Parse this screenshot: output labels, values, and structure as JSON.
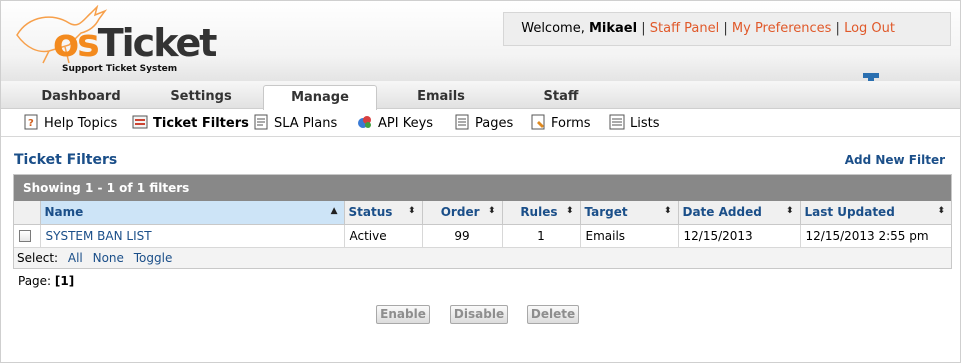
{
  "header": {
    "logo_text_os": "os",
    "logo_text_ticket": "Ticket",
    "logo_tagline": "Support Ticket System",
    "welcome_prefix": "Welcome,",
    "username": "Mikael",
    "links": [
      "Staff Panel",
      "My Preferences",
      "Log Out"
    ],
    "separator": "|",
    "accent_color": "#e0592a"
  },
  "nav": {
    "tabs": [
      {
        "label": "Dashboard",
        "active": false
      },
      {
        "label": "Settings",
        "active": false
      },
      {
        "label": "Manage",
        "active": true
      },
      {
        "label": "Emails",
        "active": false
      },
      {
        "label": "Staff",
        "active": false
      }
    ]
  },
  "subnav": {
    "items": [
      {
        "label": "Help Topics",
        "icon": "help-topics-icon",
        "active": false
      },
      {
        "label": "Ticket Filters",
        "icon": "ticket-filters-icon",
        "active": true
      },
      {
        "label": "SLA Plans",
        "icon": "sla-plans-icon",
        "active": false
      },
      {
        "label": "API Keys",
        "icon": "api-keys-icon",
        "active": false
      },
      {
        "label": "Pages",
        "icon": "pages-icon",
        "active": false
      },
      {
        "label": "Forms",
        "icon": "forms-icon",
        "active": false
      },
      {
        "label": "Lists",
        "icon": "lists-icon",
        "active": false
      }
    ]
  },
  "page": {
    "title": "Ticket Filters",
    "add_new": "Add New Filter",
    "showing": "Showing  1 - 1 of 1 filters",
    "title_color": "#1b4f89"
  },
  "table": {
    "columns": [
      "Name",
      "Status",
      "Order",
      "Rules",
      "Target",
      "Date Added",
      "Last Updated"
    ],
    "rows": [
      {
        "name": "SYSTEM BAN LIST",
        "status": "Active",
        "order": "99",
        "rules": "1",
        "target": "Emails",
        "date_added": "12/15/2013",
        "last_updated": "12/15/2013 2:55 pm"
      }
    ]
  },
  "select": {
    "label": "Select:",
    "all": "All",
    "none": "None",
    "toggle": "Toggle"
  },
  "pager": {
    "label": "Page:",
    "current": "[1]"
  },
  "actions": {
    "enable": "Enable",
    "disable": "Disable",
    "delete": "Delete"
  }
}
